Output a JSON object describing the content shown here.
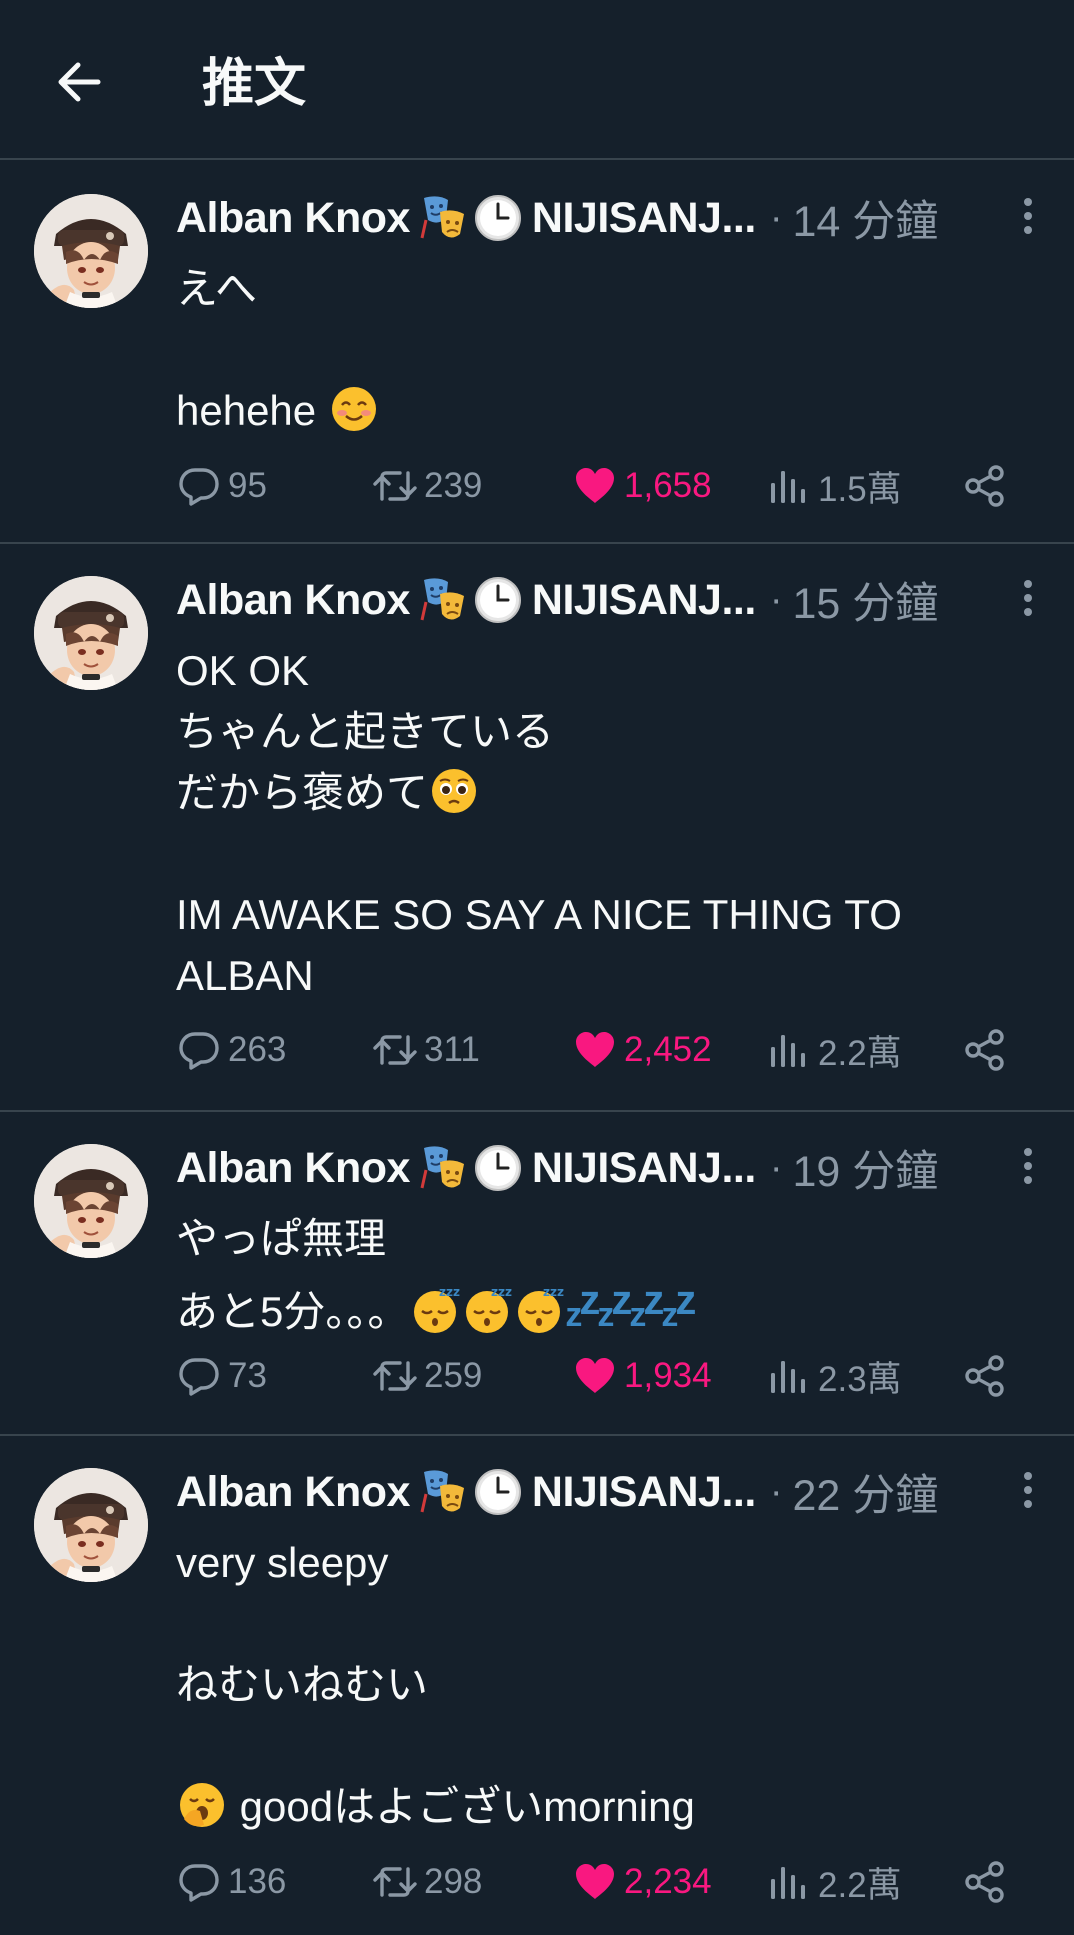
{
  "header": {
    "title": "推文"
  },
  "tweets": [
    {
      "display_name": "Alban Knox",
      "handle": "NIJISANJ...",
      "time": "14 分鐘",
      "text_lines": [
        "えへ",
        "",
        "hehehe"
      ],
      "counts": {
        "replies": "95",
        "retweets": "239",
        "likes": "1,658",
        "views": "1.5萬"
      }
    },
    {
      "display_name": "Alban Knox",
      "handle": "NIJISANJ...",
      "time": "15 分鐘",
      "text_lines": [
        "OK OK",
        "ちゃんと起きている",
        "だから褒めて",
        "",
        "IM AWAKE SO SAY A NICE THING TO",
        "ALBAN"
      ],
      "counts": {
        "replies": "263",
        "retweets": "311",
        "likes": "2,452",
        "views": "2.2萬"
      }
    },
    {
      "display_name": "Alban Knox",
      "handle": "NIJISANJ...",
      "time": "19 分鐘",
      "text_lines": [
        "やっぱ無理",
        "あと5分。。。"
      ],
      "counts": {
        "replies": "73",
        "retweets": "259",
        "likes": "1,934",
        "views": "2.3萬"
      }
    },
    {
      "display_name": "Alban Knox",
      "handle": "NIJISANJ...",
      "time": "22 分鐘",
      "text_lines": [
        "very sleepy",
        "",
        "ねむいねむい",
        "",
        "goodはよございmorning"
      ],
      "counts": {
        "replies": "136",
        "retweets": "298",
        "likes": "2,234",
        "views": "2.2萬"
      }
    }
  ],
  "colors": {
    "background": "#15202b",
    "divider": "#38444d",
    "muted": "#8b98a5",
    "like": "#f91880",
    "text": "#f7f9f9"
  },
  "icons": [
    "back-arrow-icon",
    "more-icon",
    "reply-icon",
    "retweet-icon",
    "like-icon",
    "views-icon",
    "share-icon"
  ]
}
